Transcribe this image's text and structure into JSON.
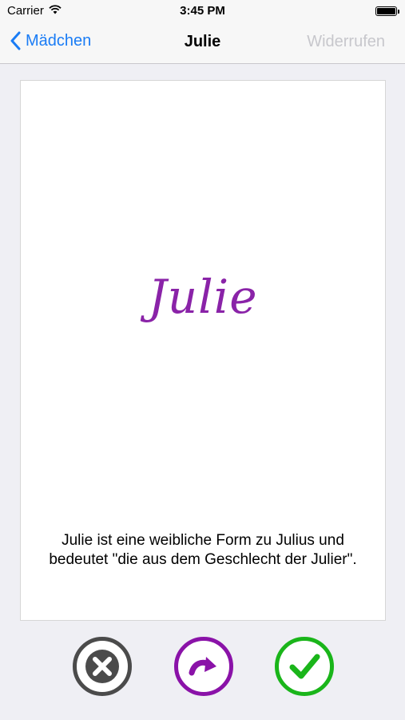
{
  "status_bar": {
    "carrier": "Carrier",
    "time": "3:45 PM"
  },
  "nav": {
    "back_label": "Mädchen",
    "title": "Julie",
    "undo_label": "Widerrufen"
  },
  "card": {
    "name": "Julie",
    "description": "Julie ist eine weibliche Form zu Julius und bedeutet \"die aus dem Geschlecht der Julier\"."
  },
  "actions": {
    "reject_icon": "close-icon",
    "skip_icon": "redo-arrow-icon",
    "accept_icon": "checkmark-icon",
    "colors": {
      "reject": "#4b4b4b",
      "skip": "#8a12a8",
      "accept": "#1ab51a",
      "name": "#8a23a8",
      "tint": "#1a7cf5"
    }
  }
}
